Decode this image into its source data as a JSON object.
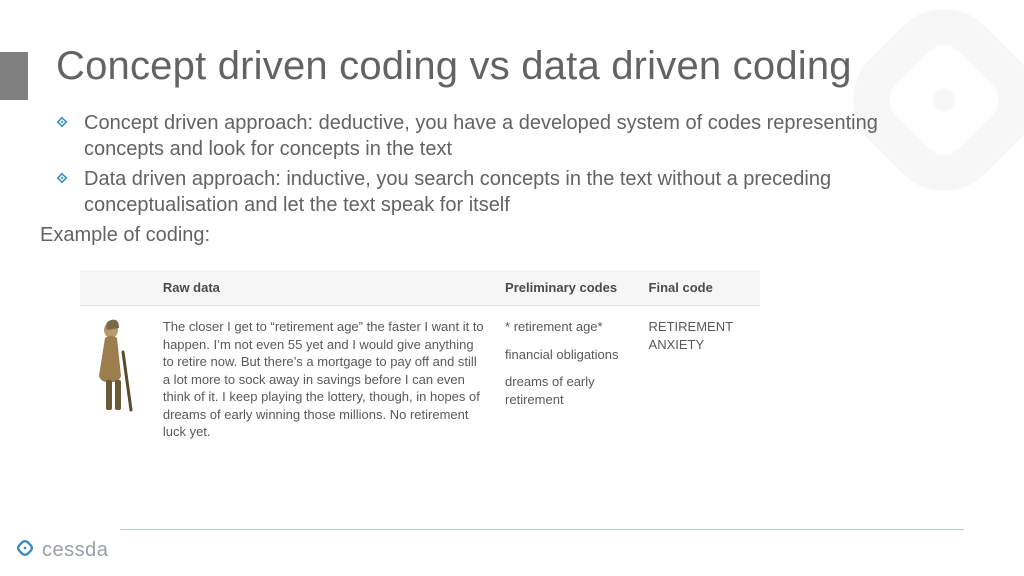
{
  "title": "Concept driven coding vs data driven coding",
  "bullets": [
    "Concept driven approach: deductive, you have a developed system of codes representing concepts and look for  concepts in the text",
    "Data driven approach: inductive, you search concepts in the text without a preceding conceptualisation and let the text speak  for itself"
  ],
  "example_label": "Example of coding:",
  "table": {
    "headers": {
      "raw": "Raw data",
      "prelim": "Preliminary codes",
      "final": "Final code"
    },
    "row": {
      "raw": "The closer I get to “retirement age” the faster I want it to happen. I’m not even 55 yet and I would give anything to retire now. But there’s a mortgage to pay off and still a lot more to sock away in savings before I can even think of it. I keep playing the lottery, though, in hopes of dreams of early winning those millions. No retirement luck yet.",
      "prelim": [
        "* retirement age*",
        "financial obligations",
        "dreams of early retirement"
      ],
      "final": "RETIREMENT ANXIETY"
    }
  },
  "footer": {
    "brand": "cessda"
  }
}
